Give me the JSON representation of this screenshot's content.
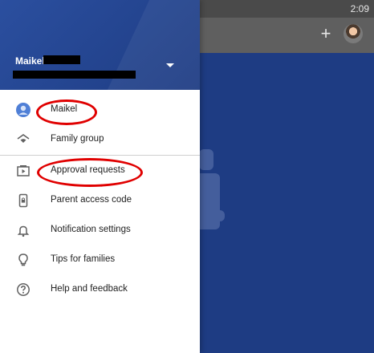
{
  "status_bar": {
    "time": "2:09"
  },
  "app_bar": {
    "add_icon": "plus-icon",
    "account_icon": "avatar"
  },
  "drawer": {
    "account": {
      "name": "Maikel",
      "dropdown_icon": "caret-down-icon"
    },
    "items": [
      {
        "label": "Maikel",
        "icon": "profile-avatar"
      },
      {
        "label": "Family group",
        "icon": "home-heart-icon"
      },
      {
        "label": "Approval requests",
        "icon": "video-play-icon"
      },
      {
        "label": "Parent access code",
        "icon": "phone-lock-icon"
      },
      {
        "label": "Notification settings",
        "icon": "bell-icon"
      },
      {
        "label": "Tips for families",
        "icon": "lightbulb-icon"
      },
      {
        "label": "Help and feedback",
        "icon": "help-icon"
      }
    ]
  },
  "annotations": {
    "highlight_color": "#e00000"
  }
}
